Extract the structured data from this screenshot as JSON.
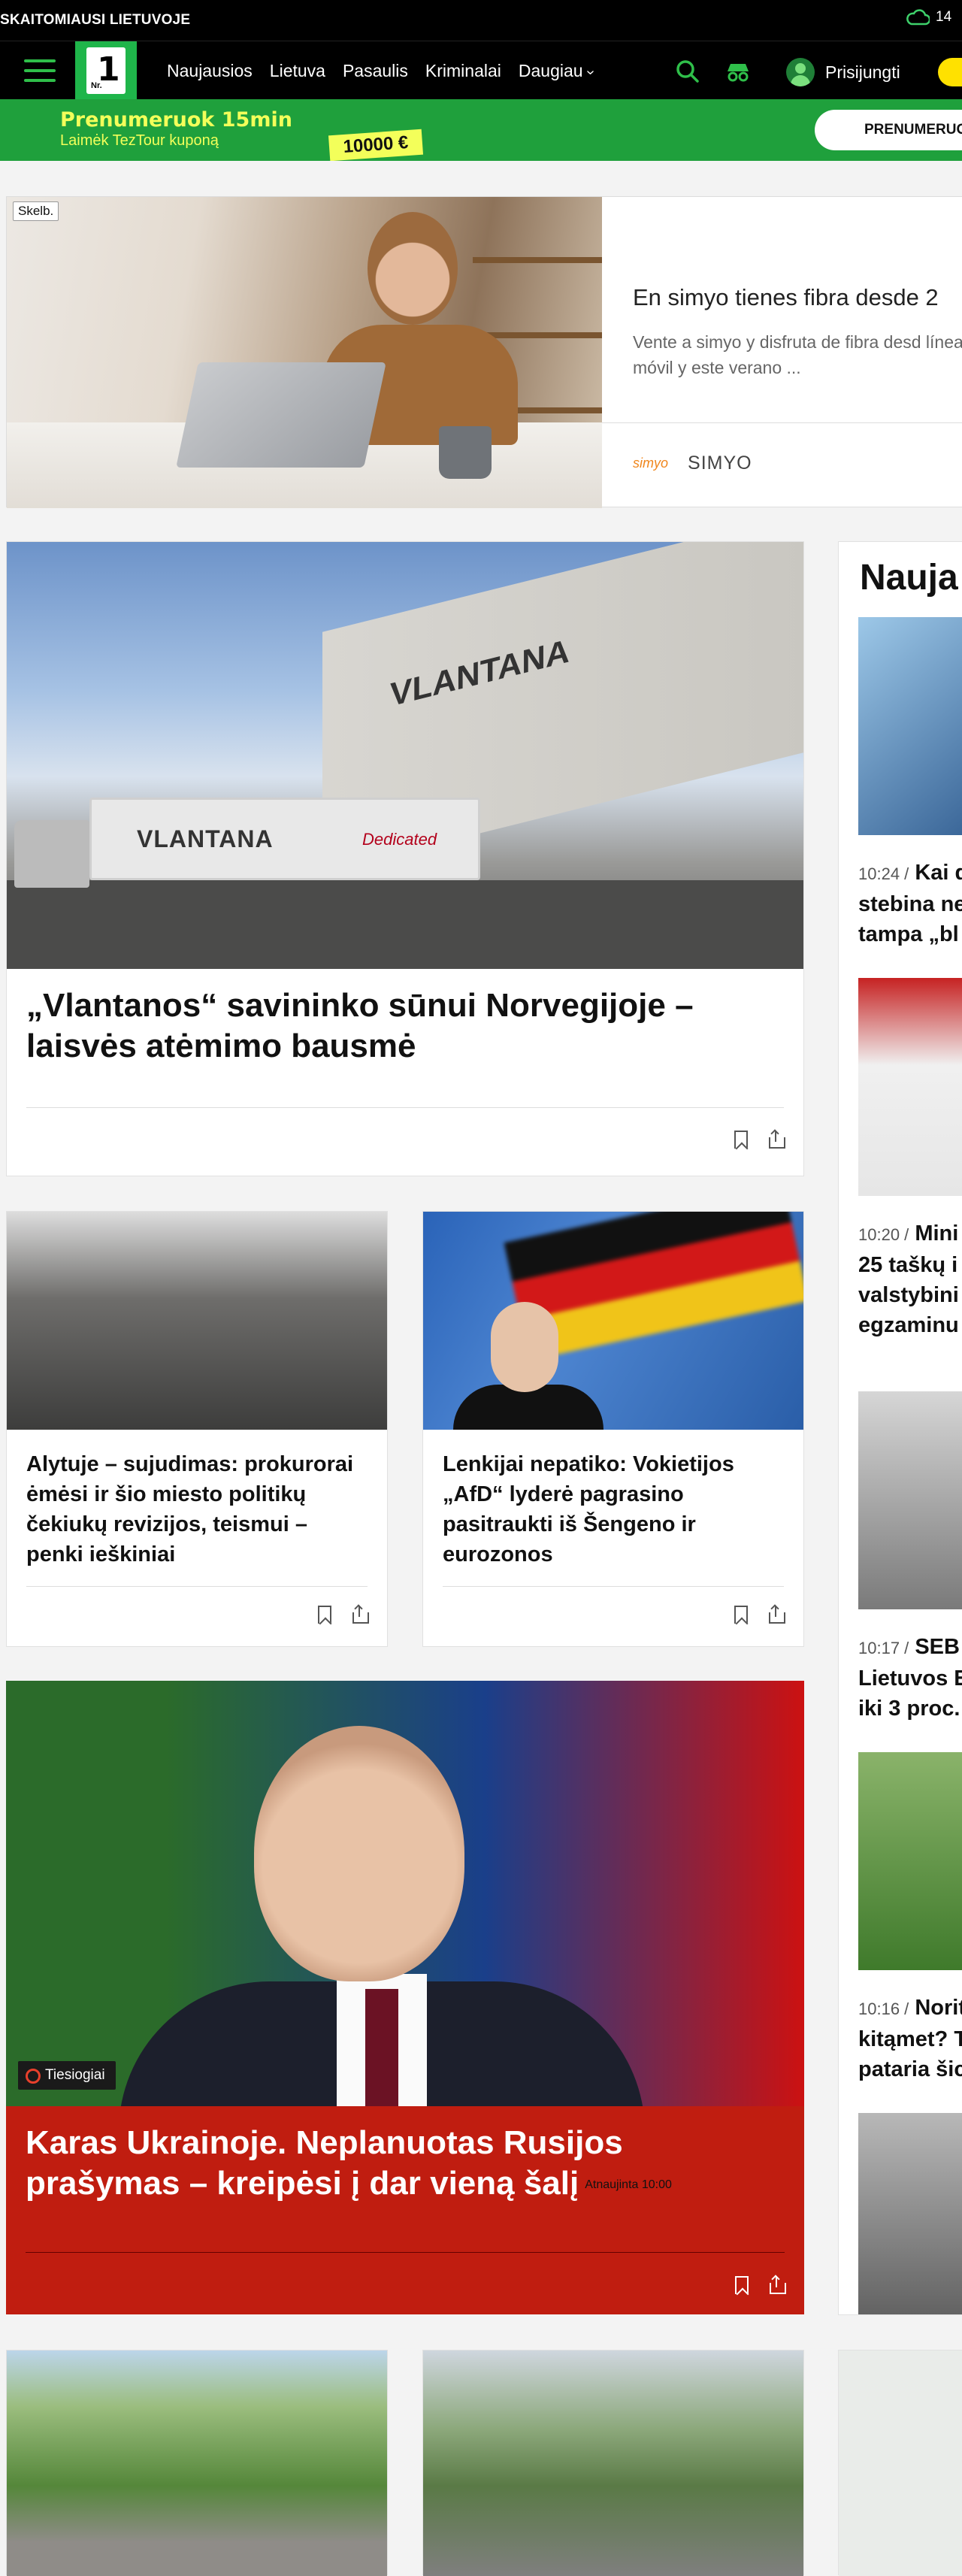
{
  "topbar": {
    "tagline": "SKAITOMIAUSI LIETUVOJE",
    "weather_temp": "14",
    "weather_icon": "cloud-icon"
  },
  "nav": {
    "logo_text": "1",
    "logo_sub": "Nr.",
    "links": [
      "Naujausios",
      "Lietuva",
      "Pasaulis",
      "Kriminalai",
      "Daugiau"
    ],
    "login": "Prisijungti"
  },
  "promo": {
    "title": "Prenumeruok 15min",
    "subtitle": "Laimėk TezTour kuponą",
    "badge": "10000 €",
    "cta": "PRENUMERUO"
  },
  "ad": {
    "label": "Skelb.",
    "headline": "En simyo tienes fibra desde 2",
    "description": "Vente a simyo y disfruta de fibra desd línea móvil y este verano ...",
    "brand_logo": "simyo",
    "brand_name": "SIMYO"
  },
  "articles": {
    "main": {
      "title": "„Vlantanos“ savininko sūnui Norvegijoje – laisvės atėmimo bausmė",
      "image_text": "VLANTANA",
      "truck_text": "VLANTANA",
      "truck_sub": "Dedicated"
    },
    "a1": {
      "title": "Alytuje – sujudimas: prokurorai ėmėsi ir šio miesto politikų čekiukų revizijos, teismui – penki ieškiniai"
    },
    "a2": {
      "title": "Lenkijai nepatiko: Vokietijos „AfD“ lyderė pagrasino pasitraukti iš Šengeno ir eurozonos"
    },
    "live": {
      "tag": "Tiesiogiai",
      "title": "Karas Ukrainoje. Neplanuotas Rusijos prašymas – kreipėsi į dar vieną šalį",
      "updated": "Atnaujinta 10:00"
    }
  },
  "sidebar": {
    "heading": "Nauja",
    "items": [
      {
        "time": "10:24 /",
        "lines": [
          "Kai d",
          "stebina ne",
          "tampa „bl"
        ]
      },
      {
        "time": "10:20 /",
        "lines": [
          "Mini",
          "25 taškų i",
          "valstybini",
          "egzaminu"
        ]
      },
      {
        "time": "10:17 /",
        "lines": [
          "SEB",
          "Lietuvos E",
          "iki 3 proc."
        ]
      },
      {
        "time": "10:16 /",
        "lines": [
          "Norit",
          "kitąmet? T",
          "pataria šic"
        ]
      }
    ]
  }
}
